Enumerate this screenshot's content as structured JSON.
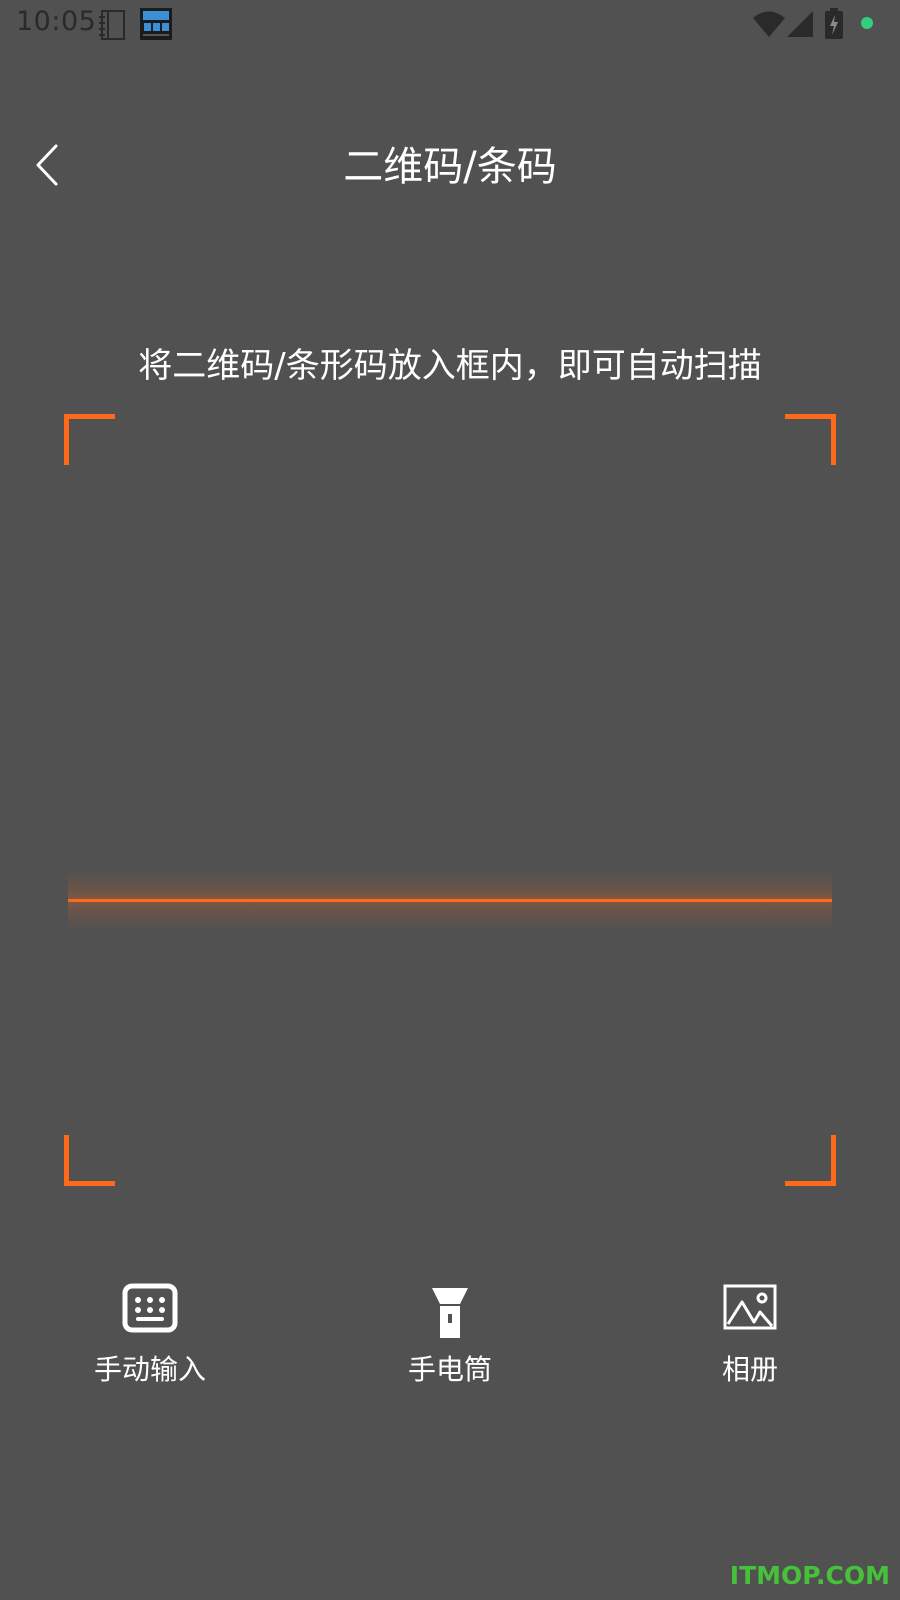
{
  "status_bar": {
    "time": "10:05",
    "icons": [
      "notebook-icon",
      "calendar-widget-icon",
      "wifi-icon",
      "cell-signal-icon",
      "battery-charging-icon",
      "notification-dot-icon"
    ],
    "dot_color": "#2fd07e"
  },
  "header": {
    "back_icon": "chevron-left-icon",
    "title": "二维码/条码"
  },
  "scanner": {
    "instruction": "将二维码/条形码放入框内，即可自动扫描",
    "accent_color": "#ff6a1a"
  },
  "actions": {
    "manual_input": {
      "label": "手动输入",
      "icon": "keyboard-icon"
    },
    "flashlight": {
      "label": "手电筒",
      "icon": "flashlight-icon"
    },
    "album": {
      "label": "相册",
      "icon": "image-icon"
    }
  },
  "watermark": "ITMOP.COM",
  "theme": {
    "background": "#515151",
    "text": "#ffffff"
  }
}
